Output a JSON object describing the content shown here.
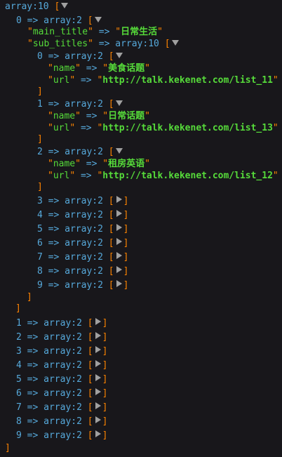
{
  "root": {
    "label": "array:10",
    "open": "[",
    "close": "]"
  },
  "entry0": {
    "index": "0",
    "arrow": "=>",
    "type": "array:2",
    "open": "[",
    "close": "]",
    "main_title": {
      "key": "main_title",
      "arrow": "=>",
      "value": "日常生活"
    },
    "sub_titles": {
      "key": "sub_titles",
      "arrow": "=>",
      "type": "array:10",
      "open": "[",
      "close": "]",
      "items": [
        {
          "index": "0",
          "type": "array:2",
          "name": "美食话题",
          "url": "http://talk.kekenet.com/list_11"
        },
        {
          "index": "1",
          "type": "array:2",
          "name": "日常话题",
          "url": "http://talk.kekenet.com/list_13"
        },
        {
          "index": "2",
          "type": "array:2",
          "name": "租房英语",
          "url": "http://talk.kekenet.com/list_12"
        }
      ],
      "item_key_name": "name",
      "item_key_url": "url",
      "collapsed": [
        "3",
        "4",
        "5",
        "6",
        "7",
        "8",
        "9"
      ],
      "collapsed_type": "array:2"
    }
  },
  "collapsed_top": [
    "1",
    "2",
    "3",
    "4",
    "5",
    "6",
    "7",
    "8",
    "9"
  ],
  "collapsed_type": "array:2",
  "arrow": "=>",
  "bracket_open": "[",
  "bracket_close": "]",
  "quote": "\""
}
